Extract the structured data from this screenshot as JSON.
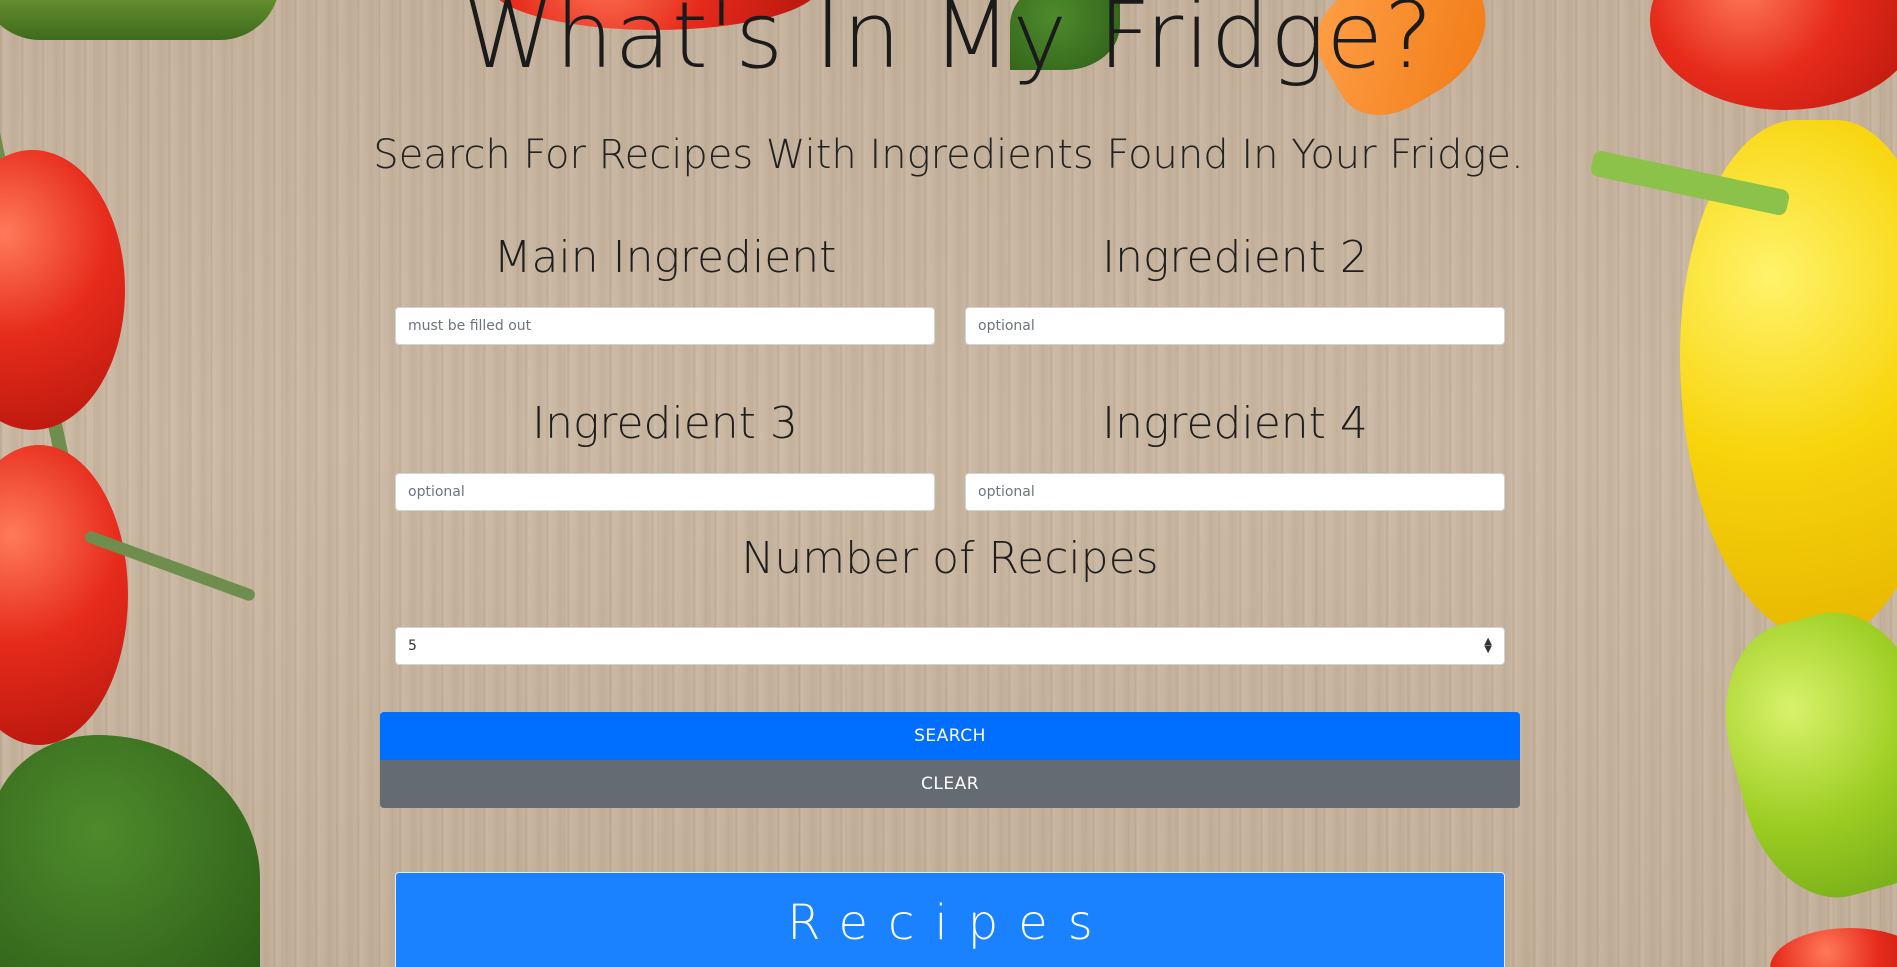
{
  "header": {
    "title": "What's In My Fridge?",
    "subtitle": "Search For Recipes With Ingredients Found In Your Fridge."
  },
  "form": {
    "main_ingredient": {
      "label": "Main Ingredient",
      "placeholder": "must be filled out",
      "value": ""
    },
    "ingredient_2": {
      "label": "Ingredient 2",
      "placeholder": "optional",
      "value": ""
    },
    "ingredient_3": {
      "label": "Ingredient 3",
      "placeholder": "optional",
      "value": ""
    },
    "ingredient_4": {
      "label": "Ingredient 4",
      "placeholder": "optional",
      "value": ""
    },
    "number_of_recipes": {
      "label": "Number of Recipes",
      "selected": "5"
    }
  },
  "buttons": {
    "search_label": "SEARCH",
    "clear_label": "CLEAR"
  },
  "results": {
    "heading": "Recipes"
  },
  "colors": {
    "search_button": "#006eff",
    "clear_button": "#646b72",
    "recipes_panel": "#1a82ff"
  }
}
